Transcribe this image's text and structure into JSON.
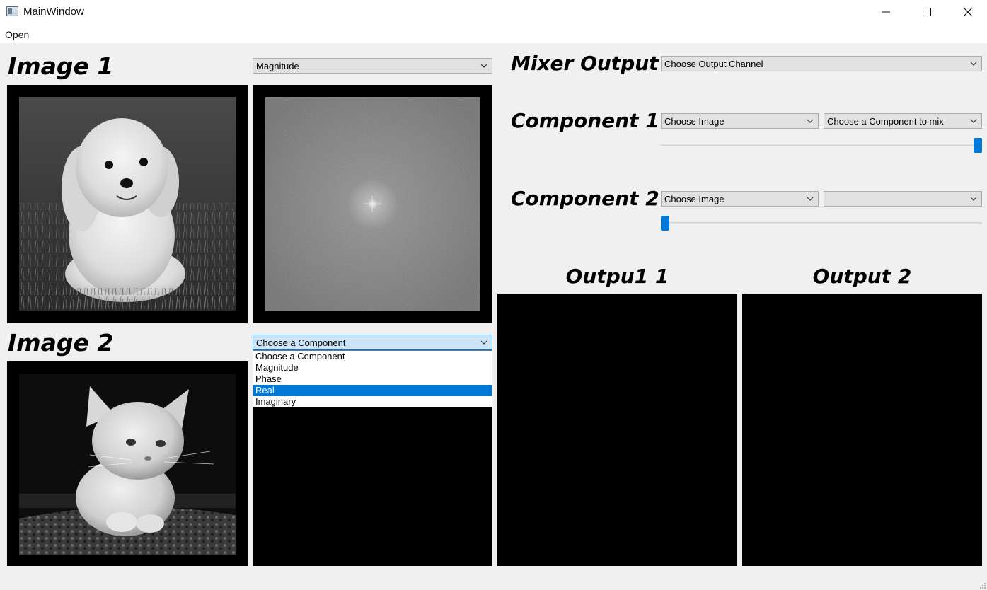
{
  "window": {
    "title": "MainWindow"
  },
  "menu": {
    "open_label": "Open"
  },
  "image1": {
    "heading": "Image 1",
    "component_selected": "Magnitude"
  },
  "image2": {
    "heading": "Image 2",
    "component_selected": "Choose a Component",
    "dropdown_options": [
      "Choose a Component",
      "Magnitude",
      "Phase",
      "Real",
      "Imaginary"
    ],
    "highlighted_option": "Real"
  },
  "mixer": {
    "heading": "Mixer Output",
    "output_channel_placeholder": "Choose Output Channel",
    "component1": {
      "heading": "Component 1",
      "image_select": "Choose Image",
      "component_select": "Choose a Component to mix",
      "ratio": 1.0
    },
    "component2": {
      "heading": "Component 2",
      "image_select": "Choose Image",
      "component_select": "",
      "ratio": 0.0
    }
  },
  "outputs": {
    "output1_heading": "Outpu1 1",
    "output2_heading": "Output 2"
  },
  "colors": {
    "accent": "#0078d7",
    "panel_bg": "#000000",
    "window_bg": "#f0f0f0"
  }
}
